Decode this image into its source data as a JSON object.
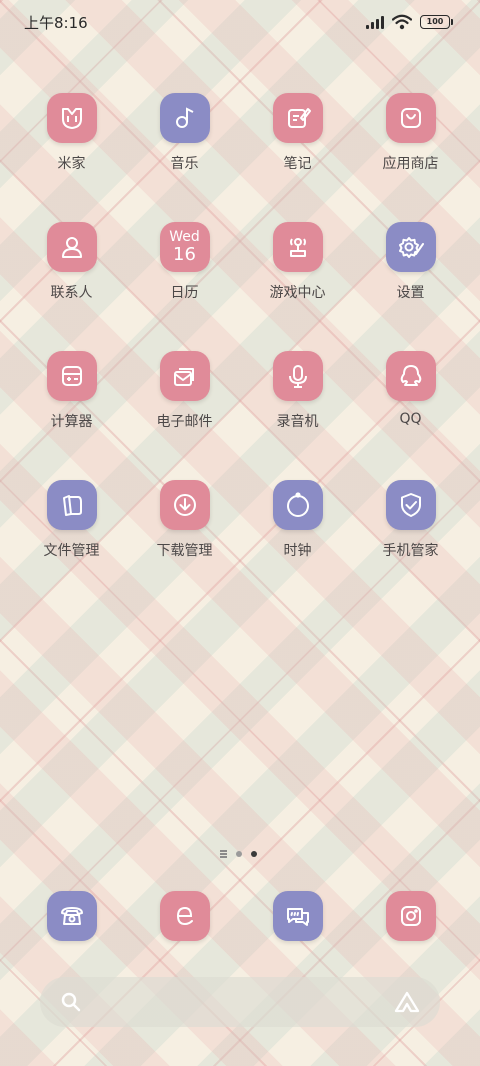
{
  "status_bar": {
    "time": "上午8:16",
    "battery": "100"
  },
  "colors": {
    "pink": "#e08b99",
    "blue": "#8b8cc5"
  },
  "apps": [
    {
      "label": "米家",
      "icon": "mi-home-icon",
      "color": "pink"
    },
    {
      "label": "音乐",
      "icon": "music-icon",
      "color": "blue"
    },
    {
      "label": "笔记",
      "icon": "notes-icon",
      "color": "pink"
    },
    {
      "label": "应用商店",
      "icon": "app-store-icon",
      "color": "pink"
    },
    {
      "label": "联系人",
      "icon": "contacts-icon",
      "color": "pink"
    },
    {
      "label": "日历",
      "icon": "calendar-icon",
      "color": "pink",
      "day": "Wed",
      "date": "16"
    },
    {
      "label": "游戏中心",
      "icon": "joystick-icon",
      "color": "pink"
    },
    {
      "label": "设置",
      "icon": "settings-icon",
      "color": "blue"
    },
    {
      "label": "计算器",
      "icon": "calculator-icon",
      "color": "pink"
    },
    {
      "label": "电子邮件",
      "icon": "email-icon",
      "color": "pink"
    },
    {
      "label": "录音机",
      "icon": "recorder-icon",
      "color": "pink"
    },
    {
      "label": "QQ",
      "icon": "qq-icon",
      "color": "pink"
    },
    {
      "label": "文件管理",
      "icon": "files-icon",
      "color": "blue"
    },
    {
      "label": "下载管理",
      "icon": "download-icon",
      "color": "pink"
    },
    {
      "label": "时钟",
      "icon": "clock-icon",
      "color": "blue"
    },
    {
      "label": "手机管家",
      "icon": "security-icon",
      "color": "blue"
    }
  ],
  "dock": [
    {
      "icon": "phone-icon",
      "color": "blue"
    },
    {
      "icon": "browser-icon",
      "color": "pink"
    },
    {
      "icon": "messages-icon",
      "color": "blue"
    },
    {
      "icon": "camera-icon",
      "color": "pink"
    }
  ],
  "page_indicator": {
    "pages": 3,
    "current": 3
  }
}
